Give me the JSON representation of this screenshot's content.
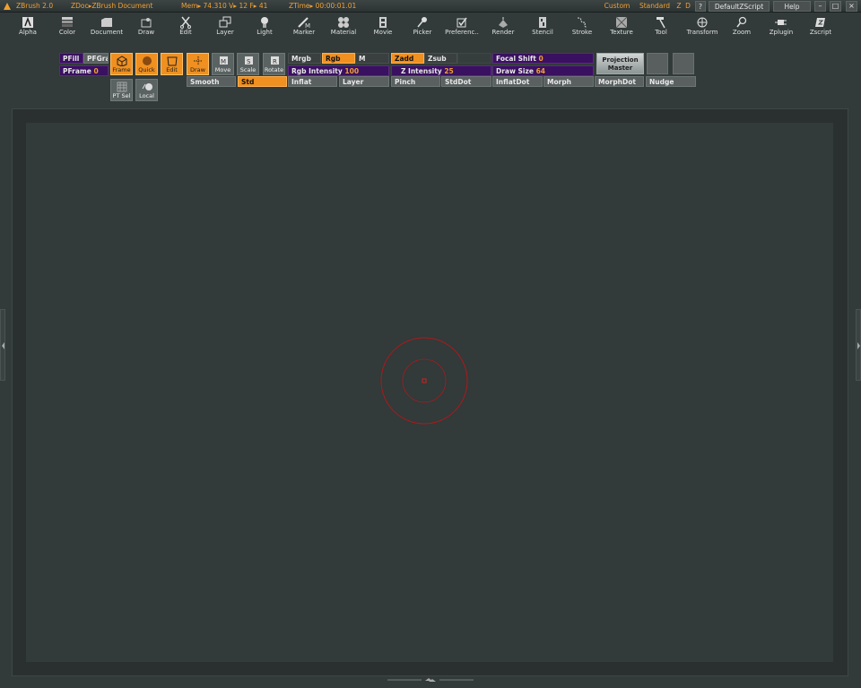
{
  "titlebar": {
    "app": "ZBrush 2.0",
    "doc": "ZDoc▸ZBrush Document",
    "mem": "Mem▸ 74.310  V▸ 12  F▸ 41",
    "ztime": "ZTime▸ 00:00:01.01",
    "buttons": {
      "custom": "Custom",
      "standard": "Standard",
      "z": "Z",
      "d": "D",
      "help_q": "?",
      "script": "DefaultZScript",
      "help": "Help"
    }
  },
  "menus": [
    "Alpha",
    "Color",
    "Document",
    "Draw",
    "Edit",
    "Layer",
    "Light",
    "Marker",
    "Material",
    "Movie",
    "Picker",
    "Preferenc..",
    "Render",
    "Stencil",
    "Stroke",
    "Texture",
    "Tool",
    "Transform",
    "Zoom",
    "Zplugin",
    "Zscript"
  ],
  "shelf": {
    "pfill": "PFill",
    "pfgra": "PFGra",
    "pframe_label": "PFrame",
    "pframe_value": "0",
    "frame": "Frame",
    "quick": "Quick",
    "edit": "Edit",
    "draw": "Draw",
    "move": "Move",
    "scale": "Scale",
    "rotate": "Rotate",
    "ptsel": "PT Sel",
    "local": "Local",
    "mrgb": "Mrgb",
    "rgb": "Rgb",
    "m": "M",
    "rgb_intensity_label": "Rgb Intensity",
    "rgb_intensity_value": "100",
    "zadd": "Zadd",
    "zsub": "Zsub",
    "z_intensity_label": "Z Intensity",
    "z_intensity_value": "25",
    "focal_shift_label": "Focal Shift",
    "focal_shift_value": "0",
    "draw_size_label": "Draw Size",
    "draw_size_value": "64",
    "projection_master": "Projection Master",
    "brushes": [
      "Smooth",
      "Std",
      "Inflat",
      "Layer",
      "Pinch",
      "StdDot",
      "InflatDot",
      "Morph",
      "MorphDot",
      "Nudge"
    ]
  },
  "colors": {
    "accent": "#f09020",
    "purple": "#3a1060",
    "canvas": "#323a3a",
    "brush_ring": "#b01818"
  }
}
